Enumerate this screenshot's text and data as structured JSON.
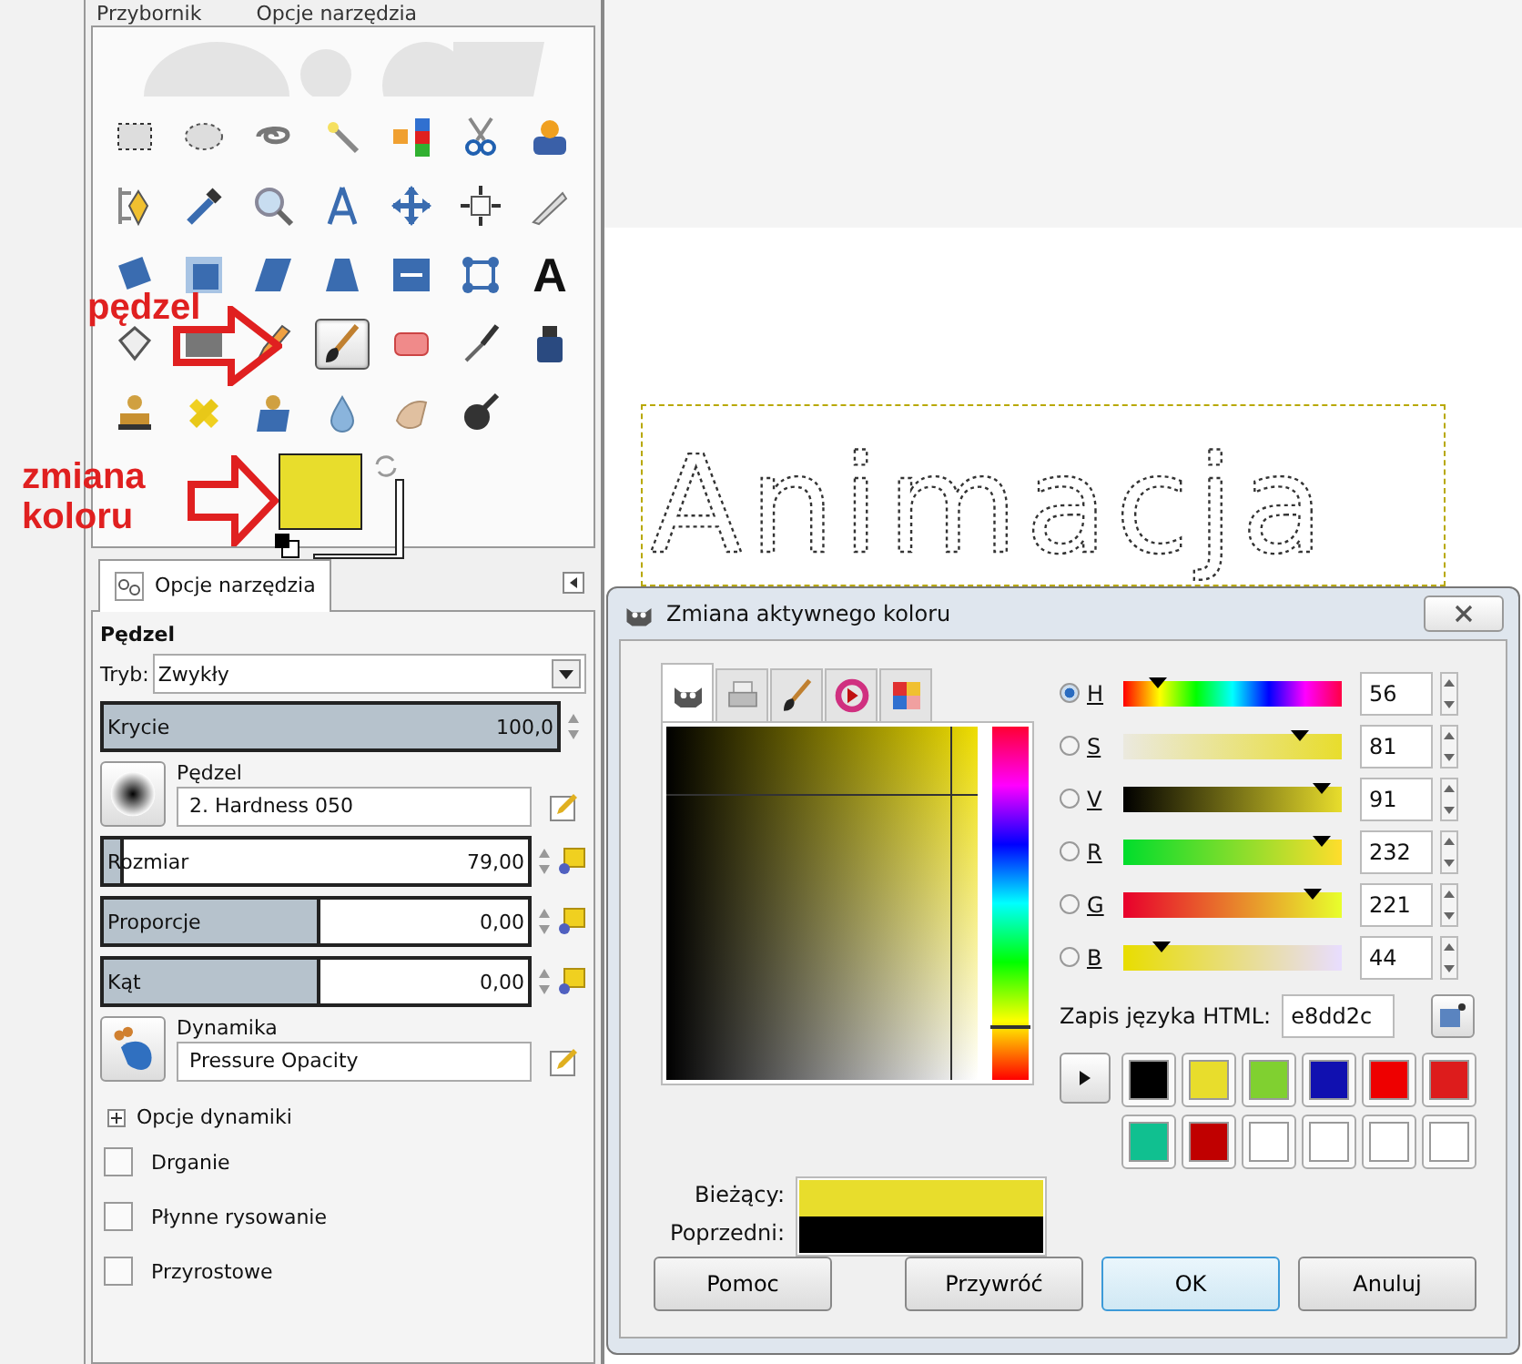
{
  "dock_tabs": [
    {
      "label": "Przybornik"
    },
    {
      "label": "Opcje narzędzia"
    }
  ],
  "tools": [
    {
      "selected": false
    },
    {
      "selected": false
    },
    {
      "selected": false
    },
    {
      "selected": false
    },
    {
      "selected": false
    },
    {
      "selected": false
    },
    {
      "selected": false
    },
    {
      "selected": false
    },
    {
      "selected": false
    },
    {
      "selected": false
    },
    {
      "selected": false
    },
    {
      "selected": false
    },
    {
      "selected": false
    },
    {
      "selected": false
    },
    {
      "selected": false
    },
    {
      "selected": false
    },
    {
      "selected": false
    },
    {
      "selected": false
    },
    {
      "selected": false
    },
    {
      "selected": false
    },
    {
      "glyph": "A",
      "selected": false
    },
    {
      "selected": false
    },
    {
      "selected": false
    },
    {
      "selected": false
    },
    {
      "selected": true
    },
    {
      "selected": false
    },
    {
      "selected": false
    },
    {
      "selected": false
    },
    {
      "selected": false
    },
    {
      "selected": false
    },
    {
      "selected": false
    },
    {
      "selected": false
    },
    {
      "selected": false
    },
    {
      "selected": false
    }
  ],
  "color_swatches": [
    {
      "color": "#e8dd2c"
    },
    {
      "color": "#ffffff"
    }
  ],
  "annotations": [
    {
      "text": "pędzel"
    },
    {
      "text": "zmiana koloru"
    }
  ],
  "tool_options": {
    "tab": "Opcje narzędzia",
    "heading": "Pędzel",
    "mode_label": "Tryb:",
    "mode": "Zwykły",
    "sliders": [
      {
        "label": "Krycie",
        "value": "100,0",
        "level": 1.0,
        "kind": "plain"
      },
      {
        "label": "Rozmiar",
        "value": "79,00",
        "level": 0.04,
        "kind": "reset"
      },
      {
        "label": "Proporcje",
        "value": "0,00",
        "level": 0.5,
        "kind": "reset"
      },
      {
        "label": "Kąt",
        "value": "0,00",
        "level": 0.5,
        "kind": "reset"
      }
    ],
    "brush": {
      "label": "Pędzel",
      "value": "2. Hardness 050"
    },
    "dynamics": {
      "label": "Dynamika",
      "value": "Pressure Opacity"
    },
    "expander": {
      "label": "Opcje dynamiki",
      "expanded": false
    },
    "checkboxes": [
      {
        "label": "Drganie",
        "checked": false
      },
      {
        "label": "Płynne rysowanie",
        "checked": false
      },
      {
        "label": "Przyrostowe",
        "checked": false
      }
    ]
  },
  "canvas": {
    "text": "Animacja"
  },
  "dialog": {
    "title": "Zmiana aktywnego koloru",
    "tabs": [
      {
        "selected": true
      },
      {
        "selected": false
      },
      {
        "selected": false
      },
      {
        "selected": false
      },
      {
        "selected": false
      }
    ],
    "channels": [
      {
        "label": "H",
        "value": "56",
        "level": 0.156,
        "selected": true
      },
      {
        "label": "S",
        "value": "81",
        "level": 0.81,
        "selected": false
      },
      {
        "label": "V",
        "value": "91",
        "level": 0.91,
        "selected": false
      },
      {
        "label": "R",
        "value": "232",
        "level": 0.91,
        "selected": false
      },
      {
        "label": "G",
        "value": "221",
        "level": 0.867,
        "selected": false
      },
      {
        "label": "B",
        "value": "44",
        "level": 0.173,
        "selected": false
      }
    ],
    "html_label": "Zapis języka HTML:",
    "html_value": "e8dd2c",
    "history": [
      {
        "color": "#000000"
      },
      {
        "color": "#e8dd2c"
      },
      {
        "color": "#80d030"
      },
      {
        "color": "#1010b0"
      },
      {
        "color": "#ee0000"
      },
      {
        "color": "#dd1c1c"
      },
      {
        "color": "#10c090"
      },
      {
        "color": "#c00000"
      },
      {
        "color": "#ffffff"
      },
      {
        "color": "#ffffff"
      },
      {
        "color": "#ffffff"
      },
      {
        "color": "#ffffff"
      }
    ],
    "current": {
      "label": "Bieżący:",
      "color": "#e8dd2c"
    },
    "previous": {
      "label": "Poprzedni:",
      "color": "#000000"
    },
    "buttons": [
      {
        "label": "Pomoc",
        "default": false
      },
      {
        "label": "Przywróć",
        "default": false
      },
      {
        "label": "OK",
        "default": true
      },
      {
        "label": "Anuluj",
        "default": false
      }
    ]
  }
}
